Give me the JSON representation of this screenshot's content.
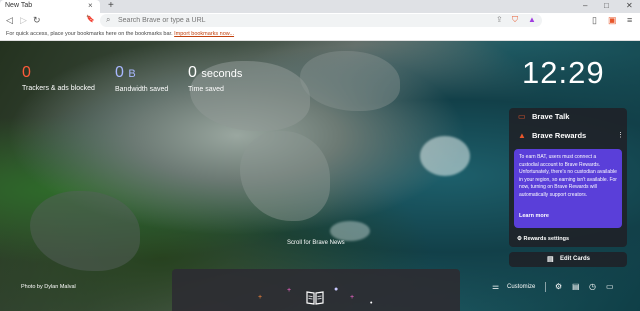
{
  "tab": {
    "title": "New Tab",
    "close": "×"
  },
  "toolbar": {
    "new_tab": "+",
    "back": "◁",
    "forward": "▷",
    "reload": "↻",
    "bookmark": "🔖",
    "url_placeholder": "Search Brave or type a URL",
    "window_controls": {
      "minimize": "–",
      "maximize": "□",
      "close": "✕"
    }
  },
  "bookmarks_bar": {
    "text": "For quick access, place your bookmarks here on the bookmarks bar.",
    "link": "Import bookmarks now..."
  },
  "stats": [
    {
      "value": "0",
      "unit": "",
      "label": "Trackers & ads blocked",
      "color": "#ff5b3a"
    },
    {
      "value": "0",
      "unit": "B",
      "label": "Bandwidth saved",
      "color": "#a9b8ff"
    },
    {
      "value": "0",
      "unit": "seconds",
      "label": "Time saved",
      "color": "#ffffff"
    }
  ],
  "clock": "12:29",
  "cards": {
    "talk_title": "Brave Talk",
    "rewards_title": "Brave Rewards",
    "rewards_info": "To earn BAT, users must connect a custodial account to Brave Rewards. Unfortunately, there's no custodian available in your region, so earning isn't available. For now, turning on Brave Rewards will automatically support creators.",
    "learn_more": "Learn more",
    "rewards_settings": "Rewards settings",
    "edit_cards": "Edit Cards"
  },
  "news": {
    "scroll_hint": "Scroll for Brave News"
  },
  "photo_credit": "Photo by Dylan Malval",
  "customize": "Customize",
  "colors": {
    "accent": "#5a3fd9",
    "stat_red": "#ff5b3a",
    "link": "#c2410c"
  }
}
